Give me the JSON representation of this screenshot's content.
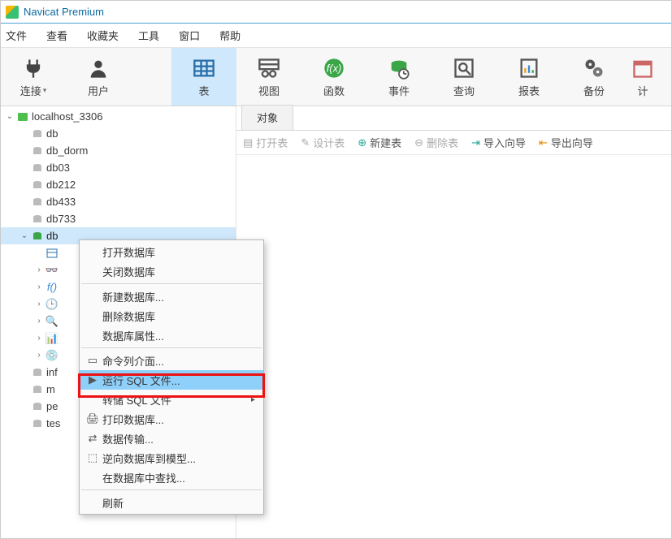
{
  "app": {
    "title": "Navicat Premium"
  },
  "menu": {
    "file": "文件",
    "view": "查看",
    "favorites": "收藏夹",
    "tools": "工具",
    "window": "窗口",
    "help": "帮助"
  },
  "toolbar": {
    "connection": "连接",
    "user": "用户",
    "table": "表",
    "view": "视图",
    "function": "函数",
    "event": "事件",
    "query": "查询",
    "report": "报表",
    "backup": "备份",
    "schedule": "计"
  },
  "tree": {
    "conn": "localhost_3306",
    "dbs": [
      "db",
      "db_dorm",
      "db03",
      "db212",
      "db433",
      "db733"
    ],
    "selected_db": "db",
    "child_partial": [
      "inf",
      "m",
      "pe",
      "tes"
    ]
  },
  "objects": {
    "tab": "对象",
    "open_table": "打开表",
    "design_table": "设计表",
    "new_table": "新建表",
    "delete_table": "删除表",
    "import_wizard": "导入向导",
    "export_wizard": "导出向导"
  },
  "context_menu": {
    "open_db": "打开数据库",
    "close_db": "关闭数据库",
    "new_db": "新建数据库...",
    "delete_db": "删除数据库",
    "db_props": "数据库属性...",
    "cmdline": "命令列介面...",
    "run_sql": "运行 SQL 文件...",
    "dump_sql": "转储 SQL 文件",
    "print_db": "打印数据库...",
    "data_transfer": "数据传输...",
    "reverse_model": "逆向数据库到模型...",
    "find_in_db": "在数据库中查找...",
    "refresh": "刷新"
  }
}
